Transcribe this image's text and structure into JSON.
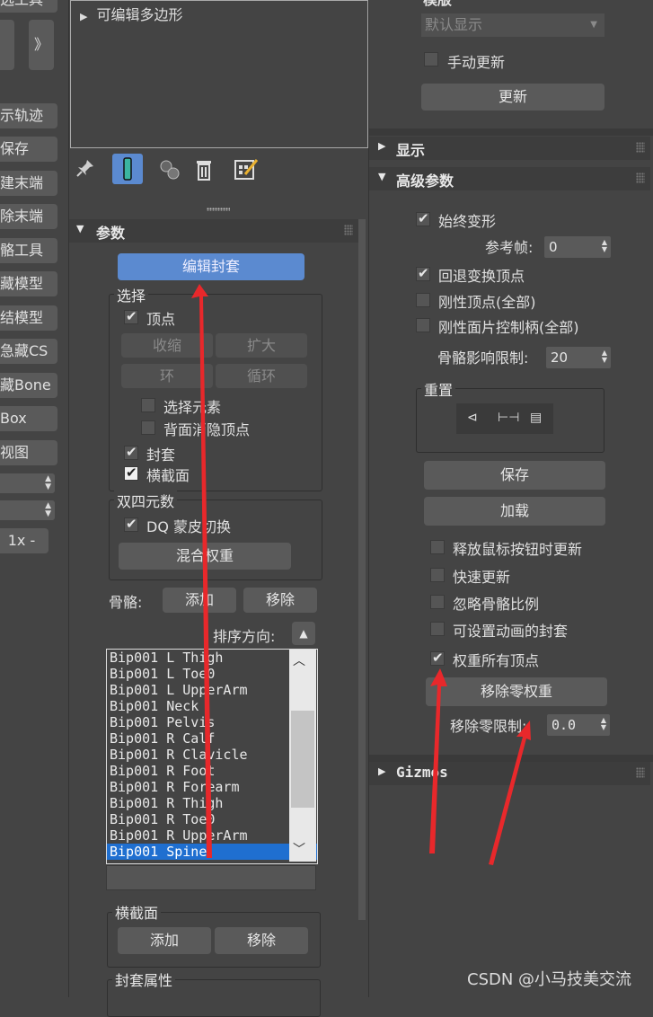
{
  "left_strip": {
    "top_label": "选工具",
    "expand_glyph": "》",
    "buttons": [
      "示轨迹",
      "保存",
      "建末端",
      "除末端",
      "骼工具",
      "藏模型",
      "结模型",
      "急藏CS",
      "藏Bone",
      "Box",
      "视图"
    ],
    "zoom_label": "1x -"
  },
  "modifier_stack": {
    "item": "可编辑多边形",
    "toolbar_icons": [
      "pin-icon",
      "show-end-result-icon",
      "make-unique-icon",
      "remove-modifier-icon",
      "configure-sets-icon"
    ]
  },
  "params": {
    "title": "参数",
    "edit_envelope": "编辑封套",
    "select_group": "选择",
    "vertices_label": "顶点",
    "shrink": "收缩",
    "grow": "扩大",
    "ring": "环",
    "loop": "循环",
    "select_element": "选择元素",
    "backface_cull": "背面消隐顶点",
    "envelopes_label": "封套",
    "cross_sections_label": "横截面",
    "dual_quat_group": "双四元数",
    "dq_toggle": "DQ 蒙皮切换",
    "blend_weights": "混合权重",
    "bones_label": "骨骼:",
    "add": "添加",
    "remove": "移除",
    "sort_label": "排序方向:",
    "bones": [
      "Bip001 L Thigh",
      "Bip001 L Toe0",
      "Bip001 L UpperArm",
      "Bip001 Neck",
      "Bip001 Pelvis",
      "Bip001 R Calf",
      "Bip001 R Clavicle",
      "Bip001 R Foot",
      "Bip001 R Forearm",
      "Bip001 R Thigh",
      "Bip001 R Toe0",
      "Bip001 R UpperArm",
      "Bip001 Spine"
    ],
    "cross_section_group": "横截面",
    "cs_add": "添加",
    "cs_remove": "移除",
    "envelope_props_group": "封套属性"
  },
  "right_panel": {
    "top_group_label": "模版",
    "display_dropdown": "默认显示",
    "manual_update": "手动更新",
    "update": "更新",
    "display_rollout": "显示",
    "advanced_rollout": "高级参数",
    "always_deform": "始终变形",
    "ref_frame_label": "参考帧:",
    "ref_frame_value": "0",
    "back_transform": "回退变换顶点",
    "rigid_vertices": "刚性顶点(全部)",
    "rigid_patch": "刚性面片控制柄(全部)",
    "bone_limit_label": "骨骼影响限制:",
    "bone_limit_value": "20",
    "reset_group": "重置",
    "save": "保存",
    "load": "加载",
    "update_on_release": "释放鼠标按钮时更新",
    "fast_update": "快速更新",
    "ignore_bone_scale": "忽略骨骼比例",
    "animatable_envelopes": "可设置动画的封套",
    "weight_all_vertices": "权重所有顶点",
    "remove_zero_weights": "移除零权重",
    "remove_zero_limit_label": "移除零限制:",
    "remove_zero_limit_value": "0.0",
    "gizmos_rollout": "Gizmos"
  },
  "watermark": "CSDN @小马技美交流",
  "colors": {
    "accent_blue": "#5b8ad0",
    "selection_blue": "#1f6fd0",
    "annotation_red": "#e8282b",
    "panel_bg": "#444444"
  }
}
